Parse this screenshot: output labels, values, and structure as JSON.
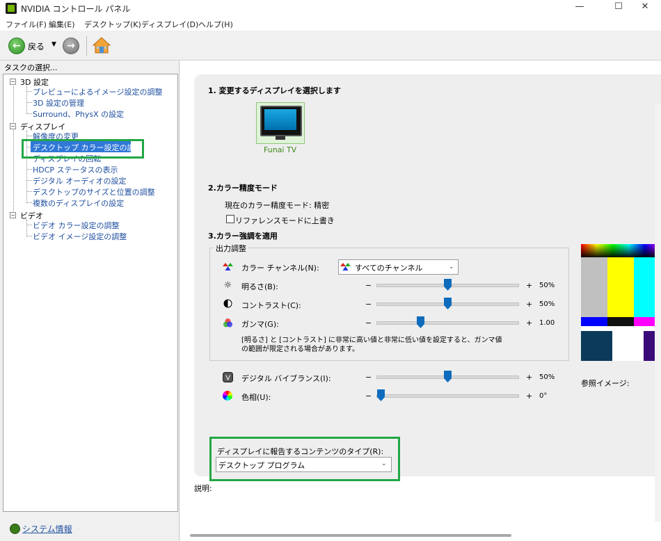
{
  "window": {
    "title": "NVIDIA コントロール パネル",
    "minimize": "—",
    "maximize": "☐",
    "close": "✕"
  },
  "menu": [
    "ファイル(F)",
    "編集(E)",
    "デスクトップ(K)",
    "ディスプレイ(D)",
    "ヘルプ(H)"
  ],
  "toolbar": {
    "back_label": "戻る",
    "back_dropdown": "▼",
    "back_arrow": "←",
    "forward_arrow": "→"
  },
  "left_panel": {
    "task_label": "タスクの選択...",
    "groups": [
      {
        "label": "3D 設定",
        "toggle": "−",
        "items": [
          "プレビューによるイメージ設定の調整",
          "3D 設定の管理",
          "Surround、PhysX の設定"
        ]
      },
      {
        "label": "ディスプレイ",
        "toggle": "−",
        "items": [
          "解像度の変更",
          "デスクトップ カラー設定の調整",
          "ディスプレイの回転",
          "HDCP ステータスの表示",
          "デジタル オーディオの設定",
          "デスクトップのサイズと位置の調整",
          "複数のディスプレイの設定"
        ]
      },
      {
        "label": "ビデオ",
        "toggle": "−",
        "items": [
          "ビデオ カラー設定の調整",
          "ビデオ イメージ設定の調整"
        ]
      }
    ],
    "selected_item": "デスクトップ カラー設定の調整",
    "system_info": "システム情報"
  },
  "content": {
    "section1": "1. 変更するディスプレイを選択します",
    "display_name": "Funai TV",
    "section2": "2.カラー精度モード",
    "current_mode": "現在のカラー精度モード: 精密",
    "override_checkbox": {
      "label": "リファレンスモードに上書き",
      "checked": false
    },
    "section3": "3.カラー強調を適用",
    "group_title": "出力調整",
    "channel": {
      "label": "カラー チャンネル(N):",
      "value": "すべてのチャンネル"
    },
    "sliders": [
      {
        "label": "明るさ(B):",
        "value_text": "50%",
        "fraction": 0.5,
        "icon": "sun-icon"
      },
      {
        "label": "コントラスト(C):",
        "value_text": "50%",
        "fraction": 0.5,
        "icon": "contrast-icon"
      },
      {
        "label": "ガンマ(G):",
        "value_text": "1.00",
        "fraction": 0.3,
        "icon": "gamma-icon"
      }
    ],
    "warning": "[明るさ] と [コントラスト] に非常に高い値と非常に低い値を設定すると、ガンマ値の範囲が限定される場合があります。",
    "extra_sliders": [
      {
        "label": "デジタル バイブランス(I):",
        "value_text": "50%",
        "fraction": 0.5,
        "icon": "vibrance-icon"
      },
      {
        "label": "色相(U):",
        "value_text": "0°",
        "fraction": 0.0,
        "icon": "hue-icon"
      }
    ],
    "minus": "−",
    "plus": "+",
    "reference_image_label": "参照イメージ:",
    "content_type": {
      "label": "ディスプレイに報告するコンテンツのタイプ(R):",
      "value": "デスクトップ プログラム"
    },
    "description_label": "説明:"
  },
  "colors": {
    "accent_blue": "#0f6cbd",
    "highlight_green": "#22a745",
    "selected_bg": "#3078d7",
    "link_blue": "#1f4fa0"
  }
}
